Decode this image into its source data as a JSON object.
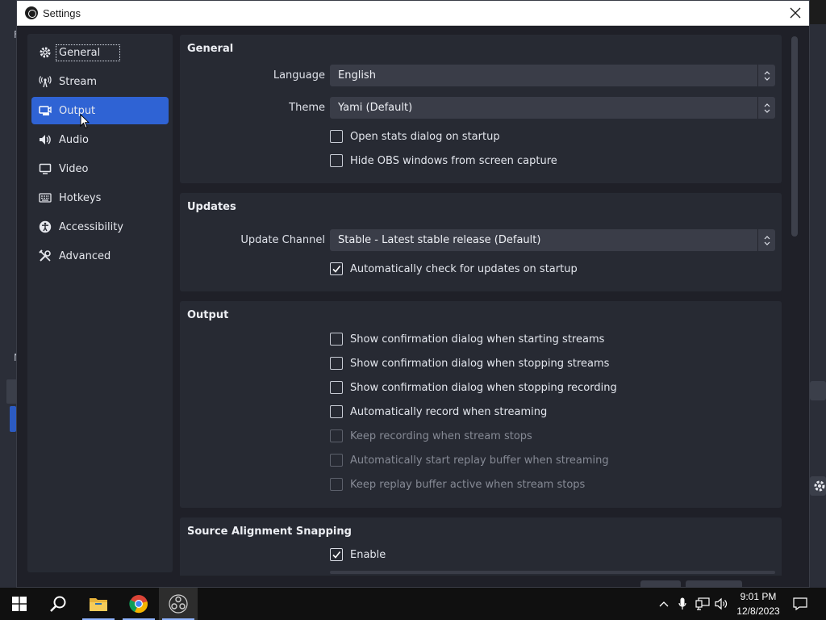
{
  "window": {
    "title": "Settings"
  },
  "background": {
    "left_fragment_1": "F",
    "left_fragment_2": "N"
  },
  "nav": {
    "items": [
      {
        "label": "General",
        "icon": "gear-icon",
        "active": false
      },
      {
        "label": "Stream",
        "icon": "antenna-icon",
        "active": false
      },
      {
        "label": "Output",
        "icon": "output-icon",
        "active": true
      },
      {
        "label": "Audio",
        "icon": "speaker-icon",
        "active": false
      },
      {
        "label": "Video",
        "icon": "monitor-icon",
        "active": false
      },
      {
        "label": "Hotkeys",
        "icon": "keyboard-icon",
        "active": false
      },
      {
        "label": "Accessibility",
        "icon": "accessibility-icon",
        "active": false
      },
      {
        "label": "Advanced",
        "icon": "tools-icon",
        "active": false
      }
    ]
  },
  "general": {
    "title": "General",
    "language_label": "Language",
    "language_value": "English",
    "theme_label": "Theme",
    "theme_value": "Yami (Default)",
    "open_stats": {
      "label": "Open stats dialog on startup",
      "checked": false
    },
    "hide_obs": {
      "label": "Hide OBS windows from screen capture",
      "checked": false
    }
  },
  "updates": {
    "title": "Updates",
    "channel_label": "Update Channel",
    "channel_value": "Stable - Latest stable release (Default)",
    "auto_check": {
      "label": "Automatically check for updates on startup",
      "checked": true
    }
  },
  "output": {
    "title": "Output",
    "options": [
      {
        "label": "Show confirmation dialog when starting streams",
        "checked": false,
        "disabled": false
      },
      {
        "label": "Show confirmation dialog when stopping streams",
        "checked": false,
        "disabled": false
      },
      {
        "label": "Show confirmation dialog when stopping recording",
        "checked": false,
        "disabled": false
      },
      {
        "label": "Automatically record when streaming",
        "checked": false,
        "disabled": false
      },
      {
        "label": "Keep recording when stream stops",
        "checked": false,
        "disabled": true
      },
      {
        "label": "Automatically start replay buffer when streaming",
        "checked": false,
        "disabled": true
      },
      {
        "label": "Keep replay buffer active when stream stops",
        "checked": false,
        "disabled": true
      }
    ]
  },
  "snapping": {
    "title": "Source Alignment Snapping",
    "enable": {
      "label": "Enable",
      "checked": true
    }
  },
  "taskbar": {
    "time": "9:01 PM",
    "date": "12/8/2023"
  },
  "colors": {
    "accent": "#2f63d4",
    "panel": "#272a33",
    "window_bg": "#1f2028",
    "taskbar": "#101010"
  }
}
